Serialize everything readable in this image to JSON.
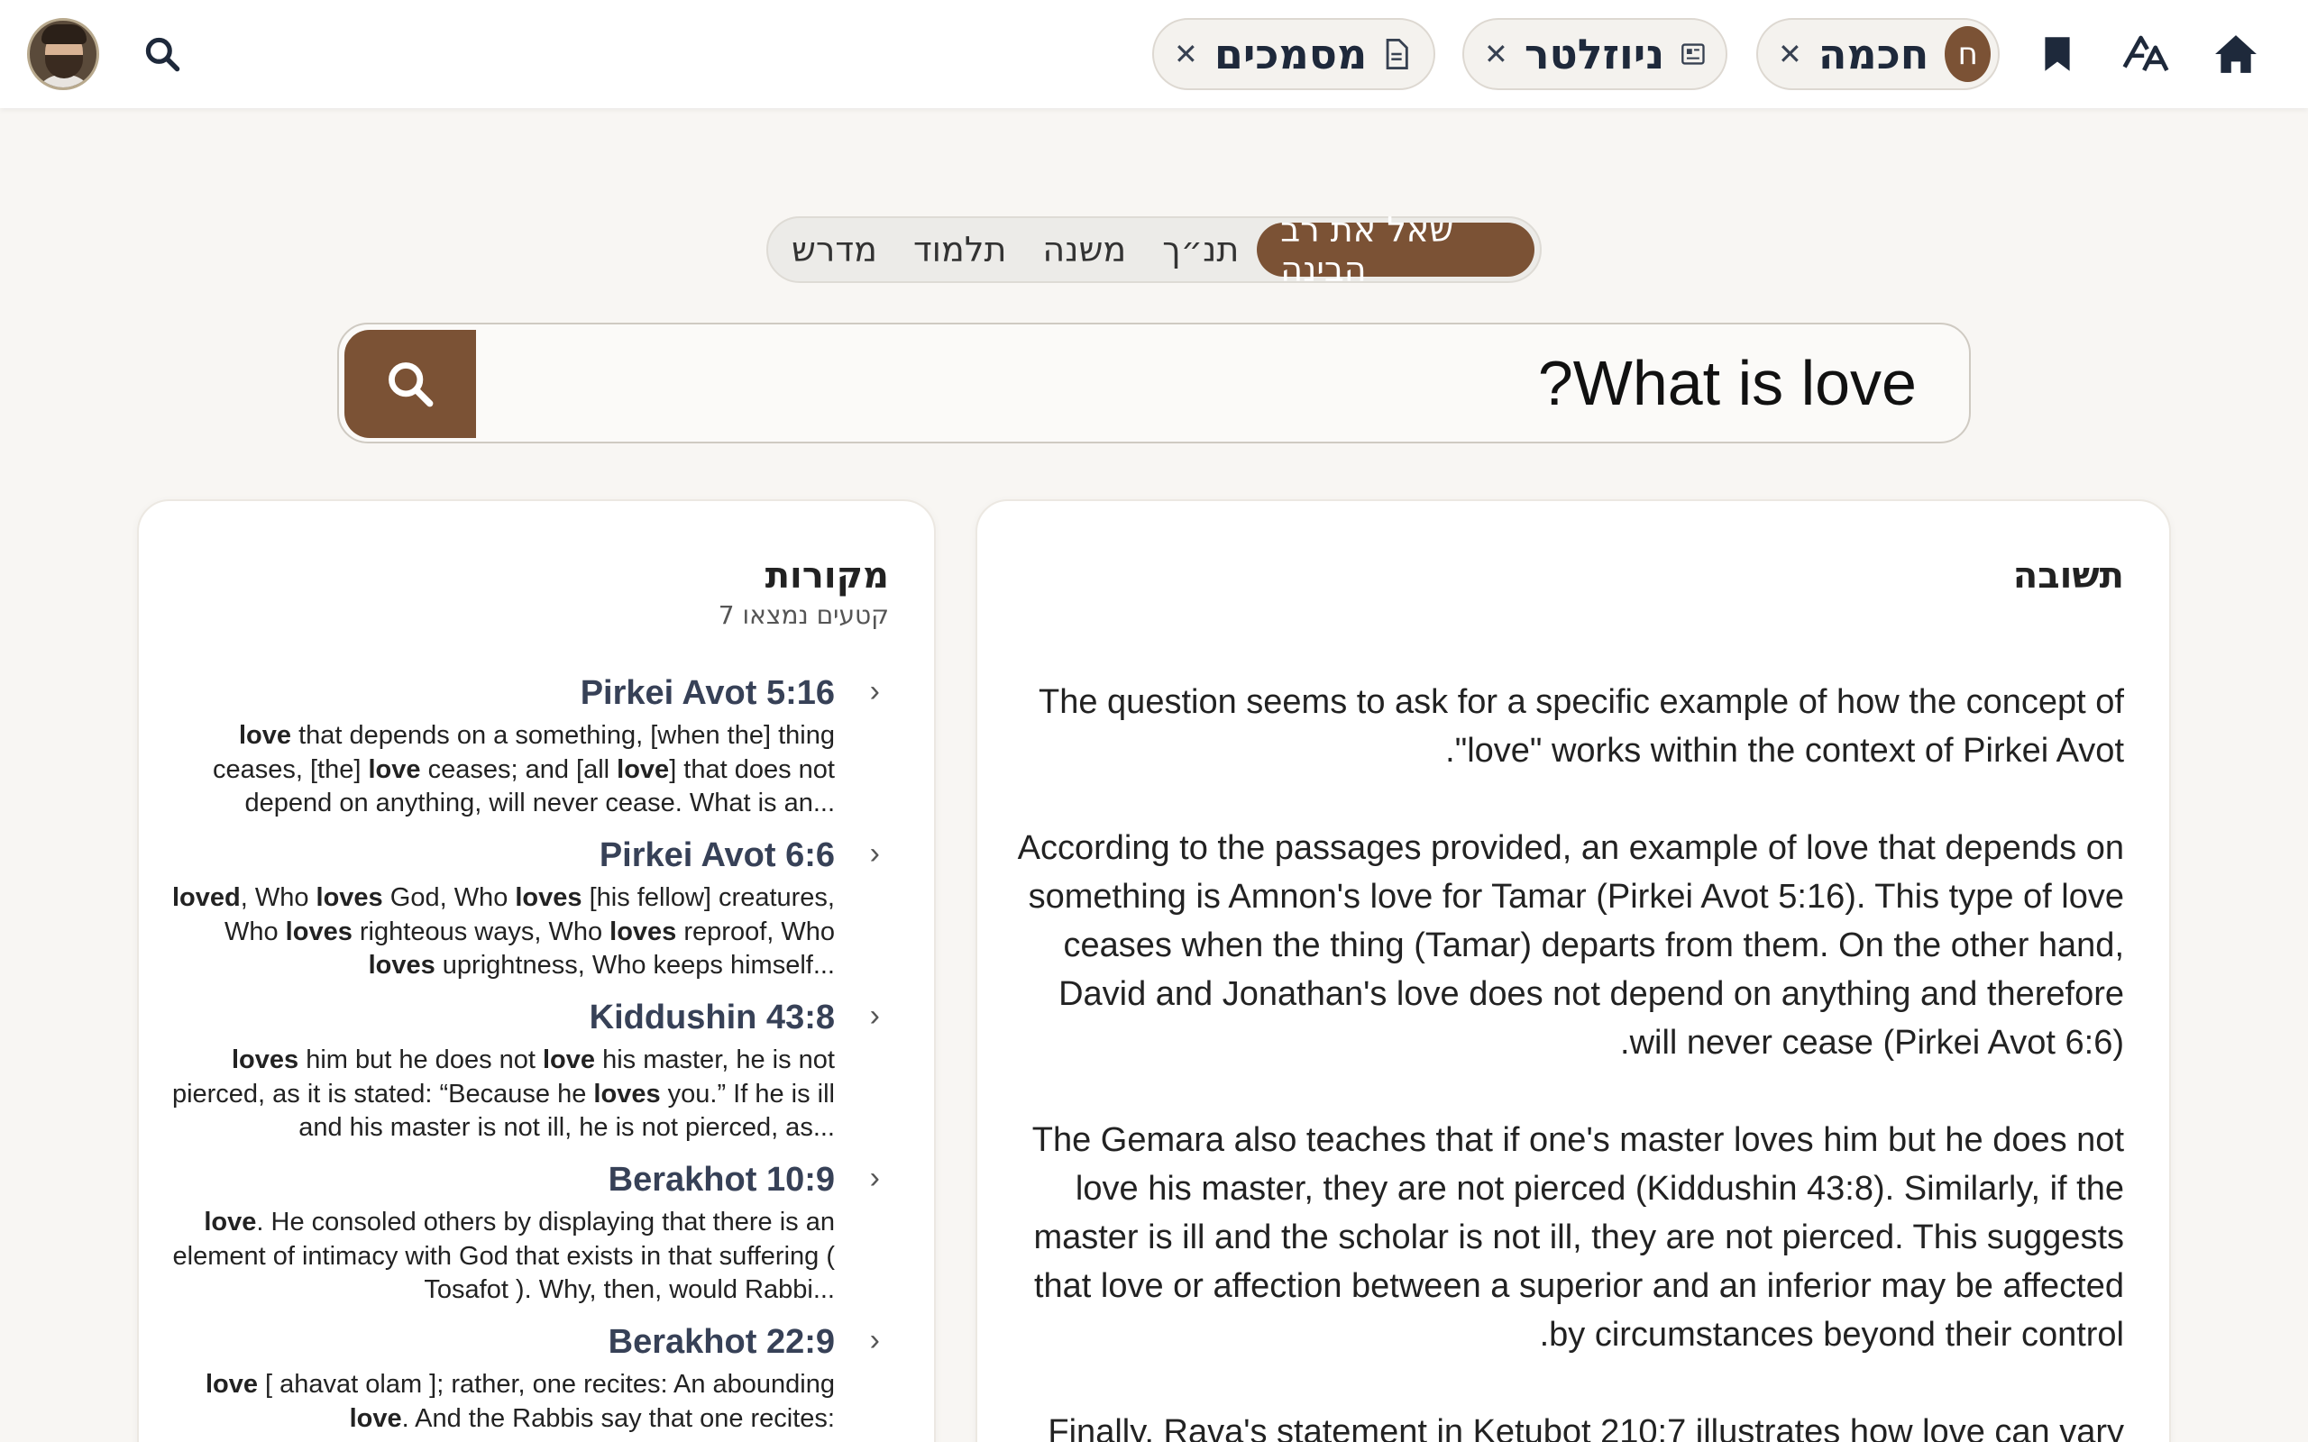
{
  "topbar": {
    "tabs": [
      {
        "label": "מסמכים",
        "close": "✕"
      },
      {
        "label": "ניוזלטר",
        "close": "✕"
      },
      {
        "label": "חכמה",
        "close": "✕",
        "badge": "ח"
      }
    ]
  },
  "modes": [
    "מדרש",
    "תלמוד",
    "משנה",
    "תנ״ך",
    "שאל את רב הבינה"
  ],
  "search": {
    "value": "What is love?"
  },
  "answer": {
    "title": "תשובה",
    "paragraphs": [
      "The question seems to ask for a specific example of how the concept of \"love\" works within the context of Pirkei Avot.",
      "According to the passages provided, an example of love that depends on something is Amnon's love for Tamar (Pirkei Avot 5:16). This type of love ceases when the thing (Tamar) departs from them. On the other hand, David and Jonathan's love does not depend on anything and therefore will never cease (Pirkei Avot 6:6).",
      "The Gemara also teaches that if one's master loves him but he does not love his master, they are not pierced (Kiddushin 43:8). Similarly, if the master is ill and the scholar is not ill, they are not pierced. This suggests that love or affection between a superior and an inferior may be affected by circumstances beyond their control.",
      "Finally, Rava's statement in Ketubot 210:7 illustrates how love can vary"
    ]
  },
  "sources": {
    "title": "מקורות",
    "count": "7 קטעים נמצאו",
    "items": [
      {
        "title": "Pirkei Avot 5:16",
        "html": "<b>love</b> that depends on a something, [when the] thing ceases, [the] <b>love</b> ceases; and [all <b>love</b>] that does not depend on anything, will never cease. What is an..."
      },
      {
        "title": "Pirkei Avot 6:6",
        "html": "<b>loved</b>, Who <b>loves</b> God, Who <b>loves</b> [his fellow] creatures, Who <b>loves</b> righteous ways, Who <b>loves</b> reproof, Who <b>loves</b> uprightness, Who keeps himself..."
      },
      {
        "title": "Kiddushin 43:8",
        "html": "<b>loves</b> him but he does not <b>love</b> his master, he is not pierced, as it is stated: “Because he <b>loves</b> you.” If he is ill and his master is not ill, he is not pierced, as..."
      },
      {
        "title": "Berakhot 10:9",
        "html": "<b>love</b>. He consoled others by displaying that there is an element of intimacy with God that exists in that suffering ( Tosafot ). Why, then, would Rabbi..."
      },
      {
        "title": "Berakhot 22:9",
        "html": "<b>love</b> [ ahavat olam ]; rather, one recites: An abounding <b>love</b>. And the Rabbis say that one recites:"
      }
    ]
  }
}
